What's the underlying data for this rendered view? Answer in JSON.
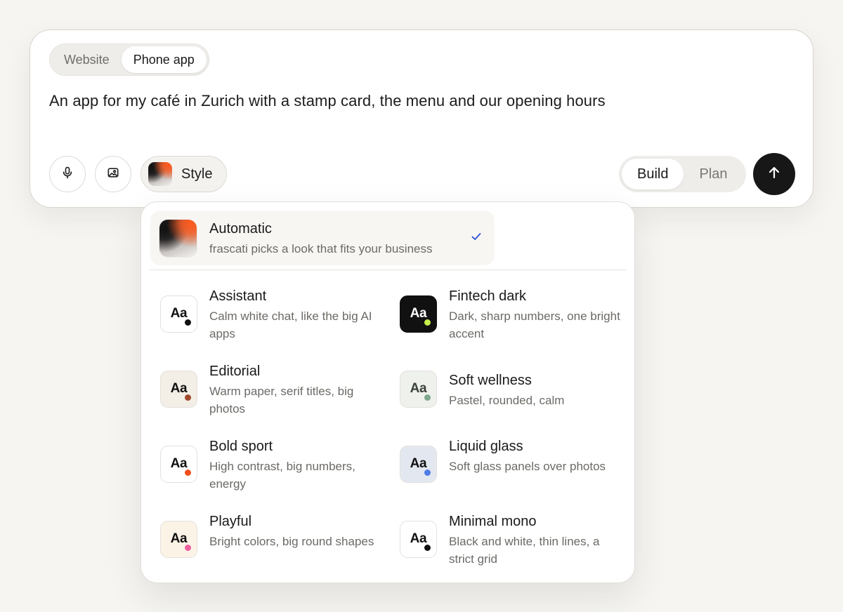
{
  "composer": {
    "target_tabs": [
      {
        "label": "Website",
        "active": false
      },
      {
        "label": "Phone app",
        "active": true
      }
    ],
    "prompt": "An app for my café in Zurich with a stamp card, the menu and our opening hours",
    "tools": {
      "mic_icon": "microphone-icon",
      "image_icon": "image-icon",
      "style_label": "Style"
    },
    "modes": [
      {
        "label": "Build",
        "active": true
      },
      {
        "label": "Plan",
        "active": false
      }
    ],
    "send_icon": "arrow-up-icon"
  },
  "style_menu": {
    "automatic": {
      "title": "Automatic",
      "description": "frascati picks a look that fits your business",
      "selected": true
    },
    "options": [
      {
        "title": "Assistant",
        "description": "Calm white chat, like the big AI apps",
        "sample": "Aa",
        "tile_bg": "#ffffff",
        "text_color": "#111111",
        "dot_color": "#111111"
      },
      {
        "title": "Fintech dark",
        "description": "Dark, sharp numbers, one bright accent",
        "sample": "Aa",
        "tile_bg": "#111111",
        "text_color": "#ffffff",
        "dot_color": "#c6f04a"
      },
      {
        "title": "Editorial",
        "description": "Warm paper, serif titles, big photos",
        "sample": "Aa",
        "tile_bg": "#f3eee6",
        "text_color": "#111111",
        "dot_color": "#a04a2a"
      },
      {
        "title": "Soft wellness",
        "description": "Pastel, rounded, calm",
        "sample": "Aa",
        "tile_bg": "#eef1ec",
        "text_color": "#3a403a",
        "dot_color": "#7fa88c"
      },
      {
        "title": "Bold sport",
        "description": "High contrast, big numbers, energy",
        "sample": "Aa",
        "tile_bg": "#ffffff",
        "text_color": "#111111",
        "dot_color": "#f0501e"
      },
      {
        "title": "Liquid glass",
        "description": "Soft glass panels over photos",
        "sample": "Aa",
        "tile_bg": "#e3e8f0",
        "text_color": "#111111",
        "dot_color": "#4f7be8"
      },
      {
        "title": "Playful",
        "description": "Bright colors, big round shapes",
        "sample": "Aa",
        "tile_bg": "#fbf3e6",
        "text_color": "#111111",
        "dot_color": "#ee5fa0"
      },
      {
        "title": "Minimal mono",
        "description": "Black and white, thin lines, a strict grid",
        "sample": "Aa",
        "tile_bg": "#ffffff",
        "text_color": "#111111",
        "dot_color": "#111111"
      }
    ]
  },
  "colors": {
    "accent_check": "#2c4fd6",
    "send_button": "#171717"
  }
}
